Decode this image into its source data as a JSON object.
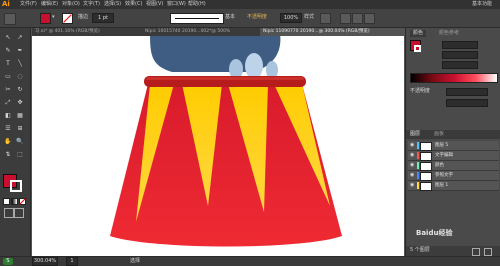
{
  "app": {
    "logo": "Ai",
    "workspace": "基本功能",
    "accent": "#ff9a00"
  },
  "menu": [
    "文件(F)",
    "编辑(E)",
    "对象(O)",
    "文字(T)",
    "选择(S)",
    "效果(C)",
    "视图(V)",
    "窗口(W)",
    "帮助(H)"
  ],
  "control": {
    "fill_color": "#c8102e",
    "stroke_label": "描边",
    "stroke_value": "1 pt",
    "style_label": "基本",
    "opacity_label": "不透明度",
    "opacity_value": "100%",
    "style2_label": "样式"
  },
  "tabs": [
    {
      "label": "马.ai* @ 401.16% (RGB/预览)",
      "active": false
    },
    {
      "label": "Nipic 10015740 20190...002*@ 500%",
      "active": false
    },
    {
      "label": "Nipic 11090770 20190...@ 300.04% (RGB/预览)",
      "active": true
    }
  ],
  "tools": [
    "↖",
    "↗",
    "✎",
    "✒",
    "T",
    "╲",
    "▭",
    "◌",
    "✂",
    "↻",
    "⤢",
    "✥",
    "◧",
    "▦",
    "☰",
    "⊞",
    "✋",
    "🔍",
    "⇅",
    "⬚"
  ],
  "artwork": {
    "top_rim": "#b71c1c",
    "red": "#e01f2b",
    "yellow": "#ffcc00",
    "foot": "#3d5a80",
    "toe": "#a9c4de"
  },
  "panel": {
    "fill_label": "颜色",
    "ref_label": "颜色参考",
    "swatch": "#c8102e",
    "opacity_label": "不透明度",
    "layers_tab": "图层",
    "artboards_tab": "画板",
    "layers": [
      {
        "name": "图层 5",
        "color": "#4fc3f7"
      },
      {
        "name": "文字编辑",
        "color": "#ff5252"
      },
      {
        "name": "颜色",
        "color": "#69f0ae"
      },
      {
        "name": "参照文字",
        "color": "#448aff"
      },
      {
        "name": "图层 1",
        "color": "#ffd740"
      }
    ],
    "layer_count": "5 个图层"
  },
  "status": {
    "zoom": "300.04%",
    "page": "1",
    "tool": "选择"
  },
  "watermark": "Baidu经验"
}
